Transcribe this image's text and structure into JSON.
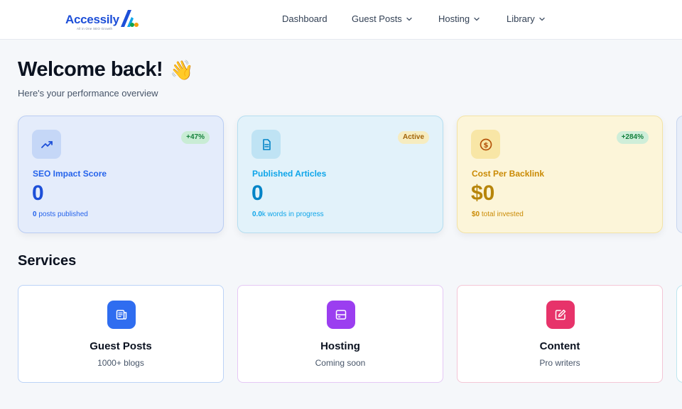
{
  "header": {
    "logo_text": "Accessily",
    "logo_tagline": "All in One SEO Growth",
    "nav": [
      {
        "label": "Dashboard",
        "has_dropdown": false
      },
      {
        "label": "Guest Posts",
        "has_dropdown": true
      },
      {
        "label": "Hosting",
        "has_dropdown": true
      },
      {
        "label": "Library",
        "has_dropdown": true
      }
    ]
  },
  "welcome": {
    "title": "Welcome back!",
    "emoji": "👋",
    "subtitle": "Here's your performance overview"
  },
  "stats": [
    {
      "icon": "trending-up-icon",
      "badge": "+47%",
      "label": "SEO Impact Score",
      "value": "0",
      "foot_strong": "0",
      "foot_rest": " posts published",
      "colors": {
        "bg": "#e4ecfb",
        "border": "#b9cdf3",
        "icon_bg": "#c5d7f7",
        "icon": "#1d4fd8",
        "label": "#2563eb",
        "value": "#1d4fd8",
        "foot": "#2563eb",
        "badge_bg": "#c9ecd5",
        "badge_fg": "#15803d"
      }
    },
    {
      "icon": "document-icon",
      "badge": "Active",
      "label": "Published Articles",
      "value": "0",
      "foot_strong": "0.0",
      "foot_rest": "k words in progress",
      "colors": {
        "bg": "#e2f2fa",
        "border": "#b5def0",
        "icon_bg": "#bfe3f4",
        "icon": "#0284c7",
        "label": "#0ea5e9",
        "value": "#0284c7",
        "foot": "#0ea5e9",
        "badge_bg": "#f6ecc0",
        "badge_fg": "#a16207"
      }
    },
    {
      "icon": "dollar-coin-icon",
      "badge": "+284%",
      "label": "Cost Per Backlink",
      "value": "$0",
      "foot_strong": "$0",
      "foot_rest": " total invested",
      "colors": {
        "bg": "#fcf5d9",
        "border": "#f3e3a5",
        "icon_bg": "#f8e6a6",
        "icon": "#b45309",
        "label": "#ca8a04",
        "value": "#b7850a",
        "foot": "#ca8a04",
        "badge_bg": "#cfeed9",
        "badge_fg": "#15803d"
      }
    }
  ],
  "services": {
    "title": "Services",
    "items": [
      {
        "icon": "newspaper-icon",
        "name": "Guest Posts",
        "desc": "1000+ blogs",
        "colors": {
          "icon_bg": "#2f6df0",
          "border": "#bcd3f7"
        }
      },
      {
        "icon": "server-icon",
        "name": "Hosting",
        "desc": "Coming soon",
        "colors": {
          "icon_bg": "#9b3ef0",
          "border": "#e5c8f5"
        }
      },
      {
        "icon": "edit-icon",
        "name": "Content",
        "desc": "Pro writers",
        "colors": {
          "icon_bg": "#e7336a",
          "border": "#f4c6d6"
        }
      }
    ]
  }
}
